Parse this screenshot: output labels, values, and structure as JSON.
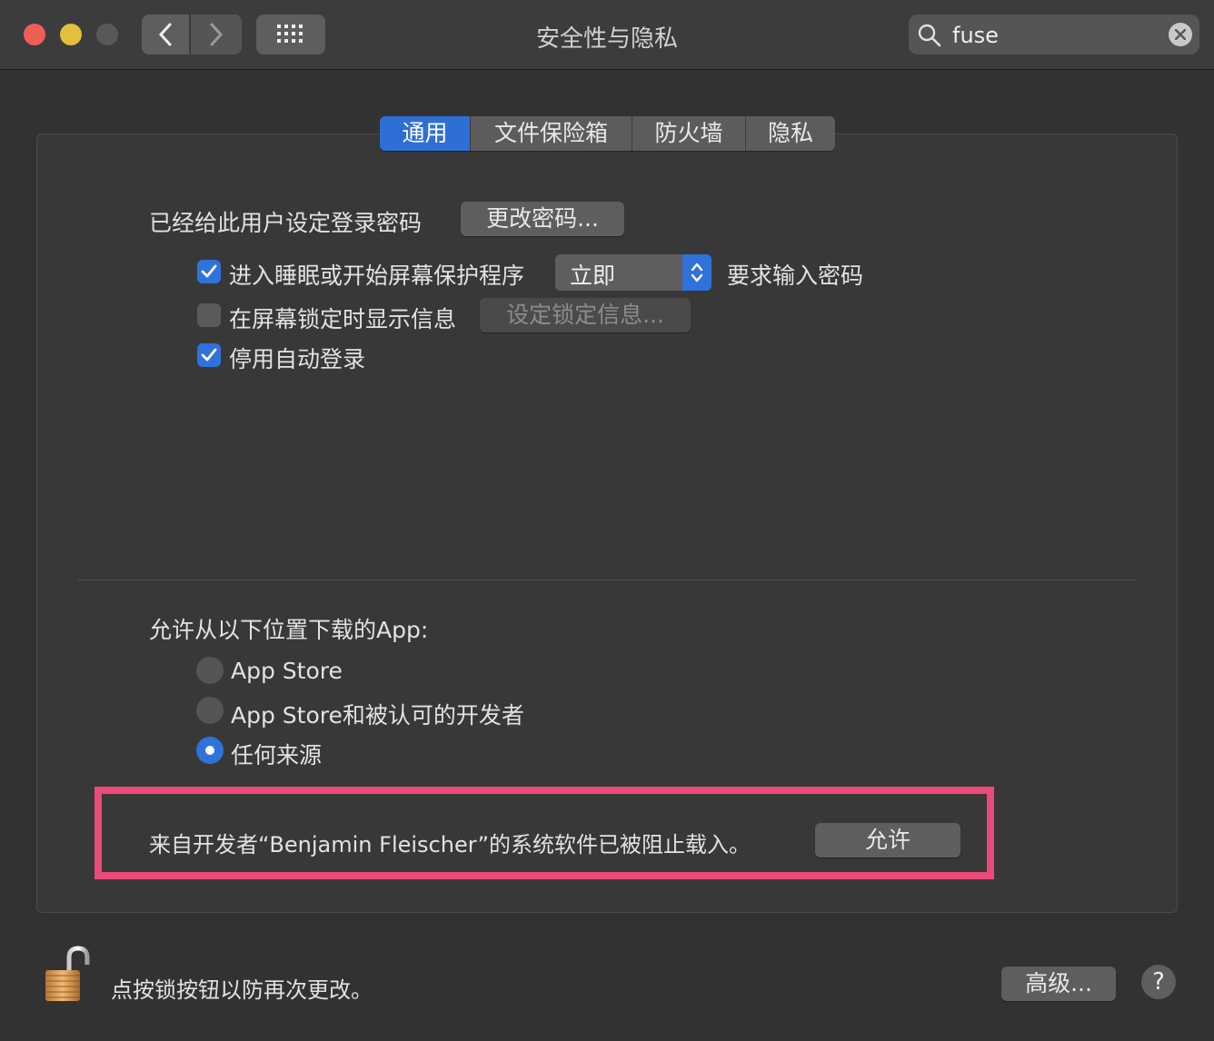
{
  "window": {
    "title": "安全性与隐私"
  },
  "search": {
    "value": "fuse"
  },
  "tabs": [
    {
      "label": "通用",
      "active": true
    },
    {
      "label": "文件保险箱",
      "active": false
    },
    {
      "label": "防火墙",
      "active": false
    },
    {
      "label": "隐私",
      "active": false
    }
  ],
  "general": {
    "password_text": "已经给此用户设定登录密码",
    "change_password_button": "更改密码...",
    "require_password": {
      "label": "进入睡眠或开始屏幕保护程序",
      "checked": true,
      "select_value": "立即",
      "suffix": "要求输入密码"
    },
    "show_message": {
      "label": "在屏幕锁定时显示信息",
      "checked": false,
      "button": "设定锁定信息..."
    },
    "disable_autologin": {
      "label": "停用自动登录",
      "checked": true
    }
  },
  "downloads": {
    "title": "允许从以下位置下载的App:",
    "options": [
      {
        "label": "App Store",
        "selected": false
      },
      {
        "label": "App Store和被认可的开发者",
        "selected": false
      },
      {
        "label": "任何来源",
        "selected": true
      }
    ]
  },
  "blocked": {
    "message": "来自开发者“Benjamin Fleischer”的系统软件已被阻止载入。",
    "allow_button": "允许"
  },
  "footer": {
    "lock_text": "点按锁按钮以防再次更改。",
    "advanced_button": "高级...",
    "help_label": "?"
  },
  "colors": {
    "accent": "#2f72dc",
    "highlight": "#ec4a7b"
  }
}
